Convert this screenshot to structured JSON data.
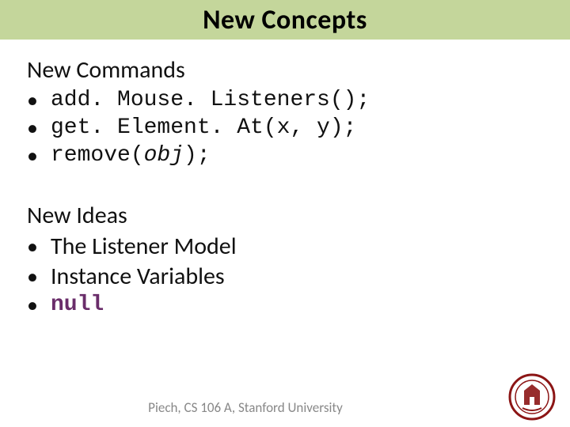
{
  "title": "New Concepts",
  "sections": {
    "commands": {
      "heading": "New Commands",
      "items": [
        {
          "pre": "add. Mouse. Listeners()",
          "arg": "",
          "post": ";"
        },
        {
          "pre": "get. Element. At(x, y)",
          "arg": "",
          "post": ";"
        },
        {
          "pre": "remove(",
          "arg": "obj",
          "post": ");"
        }
      ]
    },
    "ideas": {
      "heading": "New Ideas",
      "items": [
        "The Listener Model",
        "Instance Variables"
      ],
      "null_item": "null"
    }
  },
  "footer": "Piech, CS 106 A, Stanford University",
  "colors": {
    "titlebar_bg": "#c4d69b",
    "footer_text": "#888888",
    "null_color": "#6a2d6a",
    "seal_red": "#8c1515"
  }
}
